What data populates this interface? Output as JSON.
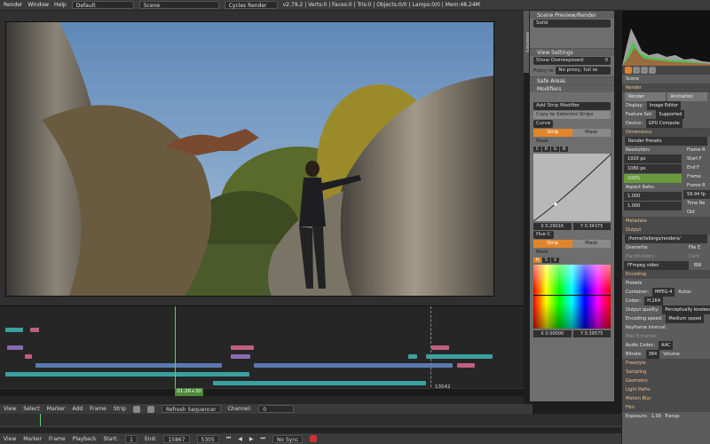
{
  "topbar": {
    "menu": [
      "Render",
      "Window",
      "Help"
    ],
    "layout": "Default",
    "scene": "Scene",
    "engine": "Cycles Render",
    "stats": "v2.79.2 | Verts:0 | Faces:0 | Tris:0 | Objects:0/0 | Lamps:0/0 | Mem:48.24M"
  },
  "npanel": {
    "tab": "Modifiers",
    "scene_preview": "Scene Preview/Render",
    "solid": "Solid",
    "view_settings": "View Settings",
    "show_overexposed": "Show Overexposed:",
    "overexposed_val": "0",
    "proxy_label": "Proxy re",
    "proxy_val": "No proxy, full re",
    "safe_areas": "Safe Areas",
    "modifiers": "Modifiers",
    "add_strip_modifier": "Add Strip Modifier",
    "copy_to_selected": "Copy to Selected Strips",
    "curve_label": "Curve",
    "strip": "Strip",
    "mask": "Mask",
    "mask_label": "Mask",
    "rgb": [
      "C",
      "R",
      "G",
      "B"
    ],
    "curve_x": "X 0.29016",
    "curve_y": "Y 0.34375",
    "hue_label": "Hue C",
    "hsv": [
      "H",
      "S",
      "V"
    ],
    "hue_x": "X 0.00000",
    "hue_y": "Y 0.39575"
  },
  "rpanel": {
    "scene": "Scene",
    "render": "Render",
    "render_btn": "Render",
    "animation_btn": "Animation",
    "display_label": "Display:",
    "display_val": "Image Editor",
    "feature_label": "Feature Set:",
    "feature_val": "Supported",
    "device_label": "Device:",
    "device_val": "GPU Compute",
    "dimensions": "Dimensions",
    "render_presets": "Render Presets",
    "resolution": "Resolution:",
    "res_x": "1920 px",
    "res_y": "1080 px",
    "res_pct": "100%",
    "frame_range": "Frame R",
    "start": "Start F",
    "end": "End F",
    "frame": "Frame",
    "aspect": "Aspect Ratio:",
    "asp_x": "1.000",
    "asp_y": "1.000",
    "frame_rate": "Frame R",
    "fps": "59.94 fp",
    "time_rem": "Time Re",
    "old": "Old",
    "metadata": "Metadata",
    "output": "Output",
    "out_path": "/home/tellergs/renders/",
    "overwrite": "Overwrite",
    "file_ext": "File E",
    "placeholders": "Placeholders",
    "cache": "Cach",
    "ffmpeg": "FFmpeg video",
    "bw": "BW",
    "encoding": "Encoding",
    "presets": "Presets",
    "container_label": "Container:",
    "container": "MPEG-4",
    "autosplit": "Autos",
    "codec_label": "Codec:",
    "codec": "H.264",
    "quality_label": "Output quality:",
    "quality": "Perceptually lossless",
    "speed_label": "Encoding speed:",
    "speed": "Medium speed",
    "keyframe": "Keyframe interval:",
    "max_b": "Max B-frames",
    "audio_label": "Audio Codec:",
    "audio": "AAC",
    "bitrate_label": "Bitrate:",
    "bitrate": "384",
    "volume": "Volume",
    "sections": [
      "Freestyle",
      "Sampling",
      "Geometry",
      "Light Paths",
      "Motion Blur",
      "Film"
    ],
    "exposure": "Exposure:",
    "exposure_val": "1.00",
    "transp": "Transp"
  },
  "seq": {
    "frame_label": "01:26+30",
    "frame_marker": "13542"
  },
  "header": {
    "items": [
      "View",
      "Select",
      "Marker",
      "Add",
      "Frame",
      "Strip"
    ],
    "refresh": "Refresh Sequencer",
    "channel_label": "Channel:",
    "channel": "0"
  },
  "timeline": {
    "items": [
      "View",
      "Marker",
      "Frame",
      "Playback"
    ],
    "start_label": "Start:",
    "start": "1",
    "end_label": "End:",
    "end": "15867",
    "current": "5305",
    "sync": "No Sync"
  }
}
